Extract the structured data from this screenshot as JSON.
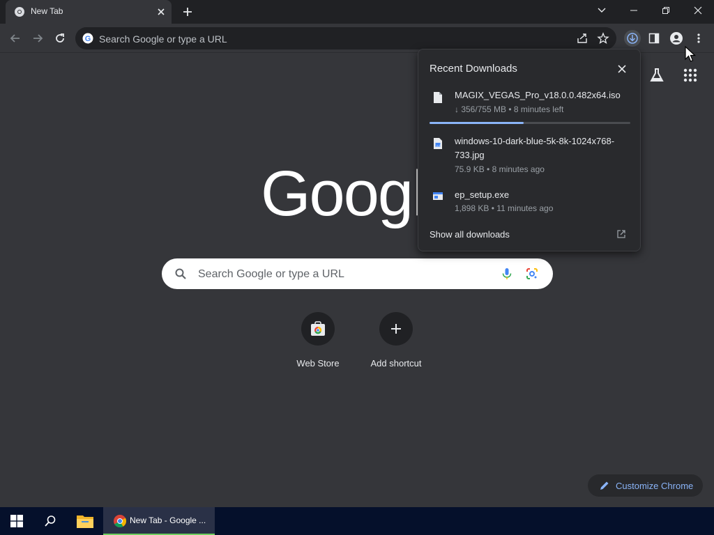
{
  "tab": {
    "title": "New Tab"
  },
  "omnibox": {
    "placeholder": "Search Google or type a URL"
  },
  "logo": {
    "text": "Googl"
  },
  "search": {
    "placeholder": "Search Google or type a URL"
  },
  "shortcuts": [
    {
      "label": "Web Store",
      "icon": "web-store-icon"
    },
    {
      "label": "Add shortcut",
      "icon": "plus-icon"
    }
  ],
  "customize": {
    "label": "Customize Chrome"
  },
  "downloads": {
    "header": "Recent Downloads",
    "items": [
      {
        "name": "MAGIX_VEGAS_Pro_v18.0.0.482x64.iso",
        "meta": "↓ 356/755 MB • 8 minutes left",
        "progress": 0.47,
        "icon": "file-icon"
      },
      {
        "name": "windows-10-dark-blue-5k-8k-1024x768-733.jpg",
        "meta": "75.9 KB • 8 minutes ago",
        "icon": "image-file-icon"
      },
      {
        "name": "ep_setup.exe",
        "meta": "1,898 KB • 11 minutes ago",
        "icon": "exe-file-icon"
      }
    ],
    "show_all": "Show all downloads"
  },
  "taskbar": {
    "chrome_label": "New Tab - Google ..."
  },
  "colors": {
    "accent": "#8ab4f8",
    "frame": "#202124",
    "toolbar": "#35363a",
    "taskbar": "#05102b"
  }
}
